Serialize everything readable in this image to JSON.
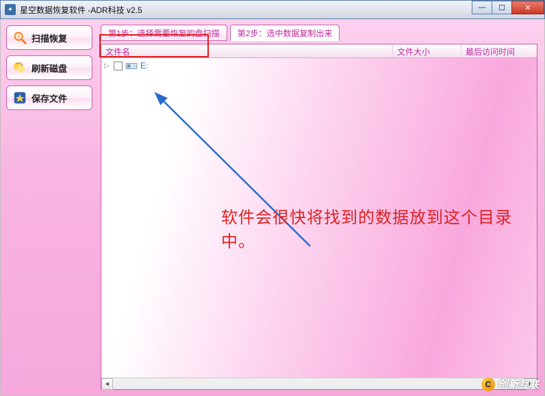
{
  "window": {
    "title": "星空数据恢复软件   -ADR科技 v2.5"
  },
  "sidebar": {
    "items": [
      {
        "label": "扫描恢复",
        "icon": "magnifier-icon"
      },
      {
        "label": "刷新磁盘",
        "icon": "refresh-icon"
      },
      {
        "label": "保存文件",
        "icon": "save-icon"
      }
    ]
  },
  "tabs": [
    {
      "label": "第1步：选择需要恢复的盘扫描",
      "active": false
    },
    {
      "label": "第2步：选中数据复制出来",
      "active": true
    }
  ],
  "file_header": {
    "name": "文件名",
    "size": "文件大小",
    "time": "最后访问时间"
  },
  "drive_row": {
    "label": "E:"
  },
  "annotation": {
    "text": "软件会很快将找到的数据放到这个目录中。"
  },
  "watermark": {
    "text": "创新互联"
  },
  "colors": {
    "accent": "#c028a0",
    "highlight": "#e21b1b",
    "link": "#2a6bd1"
  }
}
